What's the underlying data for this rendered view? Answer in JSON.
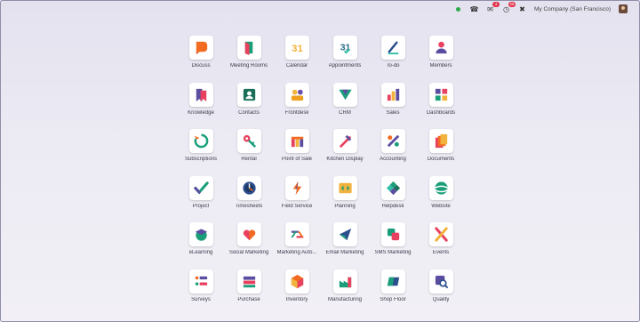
{
  "topbar": {
    "company": "My Company (San Francisco)",
    "messages_badge": "4",
    "activity_badge": "26",
    "colors": {
      "status": "#2dab4b",
      "badge": "#e0334a"
    }
  },
  "apps": [
    {
      "label": "Discuss",
      "icon": "discuss-icon"
    },
    {
      "label": "Meeting Rooms",
      "icon": "meeting-rooms-icon"
    },
    {
      "label": "Calendar",
      "icon": "calendar-icon"
    },
    {
      "label": "Appointments",
      "icon": "appointments-icon"
    },
    {
      "label": "To-do",
      "icon": "todo-icon"
    },
    {
      "label": "Members",
      "icon": "members-icon"
    },
    {
      "label": "Knowledge",
      "icon": "knowledge-icon"
    },
    {
      "label": "Contacts",
      "icon": "contacts-icon"
    },
    {
      "label": "Frontdesk",
      "icon": "frontdesk-icon"
    },
    {
      "label": "CRM",
      "icon": "crm-icon"
    },
    {
      "label": "Sales",
      "icon": "sales-icon"
    },
    {
      "label": "Dashboards",
      "icon": "dashboards-icon"
    },
    {
      "label": "Subscriptions",
      "icon": "subscriptions-icon"
    },
    {
      "label": "Rental",
      "icon": "rental-icon"
    },
    {
      "label": "Point of Sale",
      "icon": "point-of-sale-icon"
    },
    {
      "label": "Kitchen Display",
      "icon": "kitchen-display-icon"
    },
    {
      "label": "Accounting",
      "icon": "accounting-icon"
    },
    {
      "label": "Documents",
      "icon": "documents-icon"
    },
    {
      "label": "Project",
      "icon": "project-icon"
    },
    {
      "label": "Timesheets",
      "icon": "timesheets-icon"
    },
    {
      "label": "Field Service",
      "icon": "field-service-icon"
    },
    {
      "label": "Planning",
      "icon": "planning-icon"
    },
    {
      "label": "Helpdesk",
      "icon": "helpdesk-icon"
    },
    {
      "label": "Website",
      "icon": "website-icon"
    },
    {
      "label": "eLearning",
      "icon": "elearning-icon"
    },
    {
      "label": "Social Marketing",
      "icon": "social-marketing-icon"
    },
    {
      "label": "Marketing Auto...",
      "icon": "marketing-automation-icon"
    },
    {
      "label": "Email Marketing",
      "icon": "email-marketing-icon"
    },
    {
      "label": "SMS Marketing",
      "icon": "sms-marketing-icon"
    },
    {
      "label": "Events",
      "icon": "events-icon"
    },
    {
      "label": "Surveys",
      "icon": "surveys-icon"
    },
    {
      "label": "Purchase",
      "icon": "purchase-icon"
    },
    {
      "label": "Inventory",
      "icon": "inventory-icon"
    },
    {
      "label": "Manufacturing",
      "icon": "manufacturing-icon"
    },
    {
      "label": "Shop Floor",
      "icon": "shop-floor-icon"
    },
    {
      "label": "Quality",
      "icon": "quality-icon"
    }
  ]
}
